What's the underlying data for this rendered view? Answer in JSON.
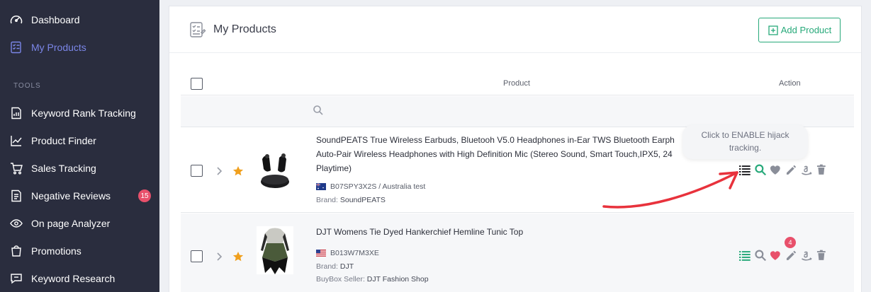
{
  "sidebar": {
    "items_top": [
      {
        "label": "Dashboard",
        "icon": "gauge-icon",
        "active": false
      },
      {
        "label": "My Products",
        "icon": "checklist-icon",
        "active": true
      }
    ],
    "section_label": "TOOLS",
    "tools": [
      {
        "label": "Keyword Rank Tracking",
        "icon": "chart-doc-icon"
      },
      {
        "label": "Product Finder",
        "icon": "line-chart-icon"
      },
      {
        "label": "Sales Tracking",
        "icon": "cart-icon"
      },
      {
        "label": "Negative Reviews",
        "icon": "document-icon",
        "badge": "15"
      },
      {
        "label": "On page Analyzer",
        "icon": "eye-icon"
      },
      {
        "label": "Promotions",
        "icon": "bag-icon"
      },
      {
        "label": "Keyword Research",
        "icon": "keyword-icon"
      }
    ],
    "accent_color": "#7b86e8"
  },
  "header": {
    "title": "My Products",
    "add_button_label": "Add Product"
  },
  "table": {
    "columns": {
      "product": "Product",
      "action": "Action"
    },
    "rows": [
      {
        "title": "SoundPEATS True Wireless Earbuds, Bluetooh V5.0 Headphones in-Ear TWS Bluetooth Earph",
        "title_line2": "Auto-Pair Wireless Headphones with High Definition Mic (Stereo Sound, Smart Touch,IPX5, 24",
        "title_line3": "Playtime)",
        "flag": "australia-flag-icon",
        "asin_text": "B07SPY3X2S / Australia test",
        "brand_label": "Brand: ",
        "brand": "SoundPEATS"
      },
      {
        "title": "DJT Womens Tie Dyed Hankerchief Hemline Tunic Top",
        "flag": "usa-flag-icon",
        "asin_text": "B013W7M3XE",
        "brand_label": "Brand: ",
        "brand": "DJT",
        "seller_label": "BuyBox Seller: ",
        "seller": "DJT Fashion Shop",
        "heart_badge": "4"
      }
    ]
  },
  "tooltip": {
    "line1": "Click to ENABLE hijack",
    "line2": "tracking."
  },
  "colors": {
    "green": "#27a97a",
    "badge_red": "#e8506b",
    "annotation_red": "#e8323c"
  }
}
